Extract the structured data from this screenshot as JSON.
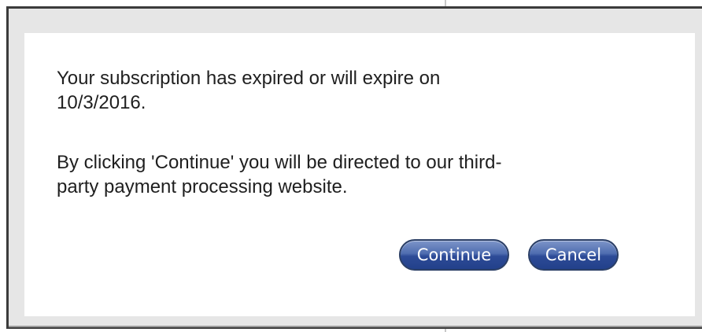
{
  "dialog": {
    "message_expiry": "Your subscription has expired or will expire on\n10/3/2016.",
    "message_redirect": "By clicking 'Continue' you will be directed to our third-\nparty payment processing website.",
    "continue_label": "Continue",
    "cancel_label": "Cancel"
  },
  "colors": {
    "button_top": "#7d95c9",
    "button_bottom": "#22408a",
    "button_border": "#2b3f66",
    "frame_border": "#3b3b3b",
    "dialog_bg": "#ffffff",
    "frame_bg": "#e6e6e6"
  }
}
